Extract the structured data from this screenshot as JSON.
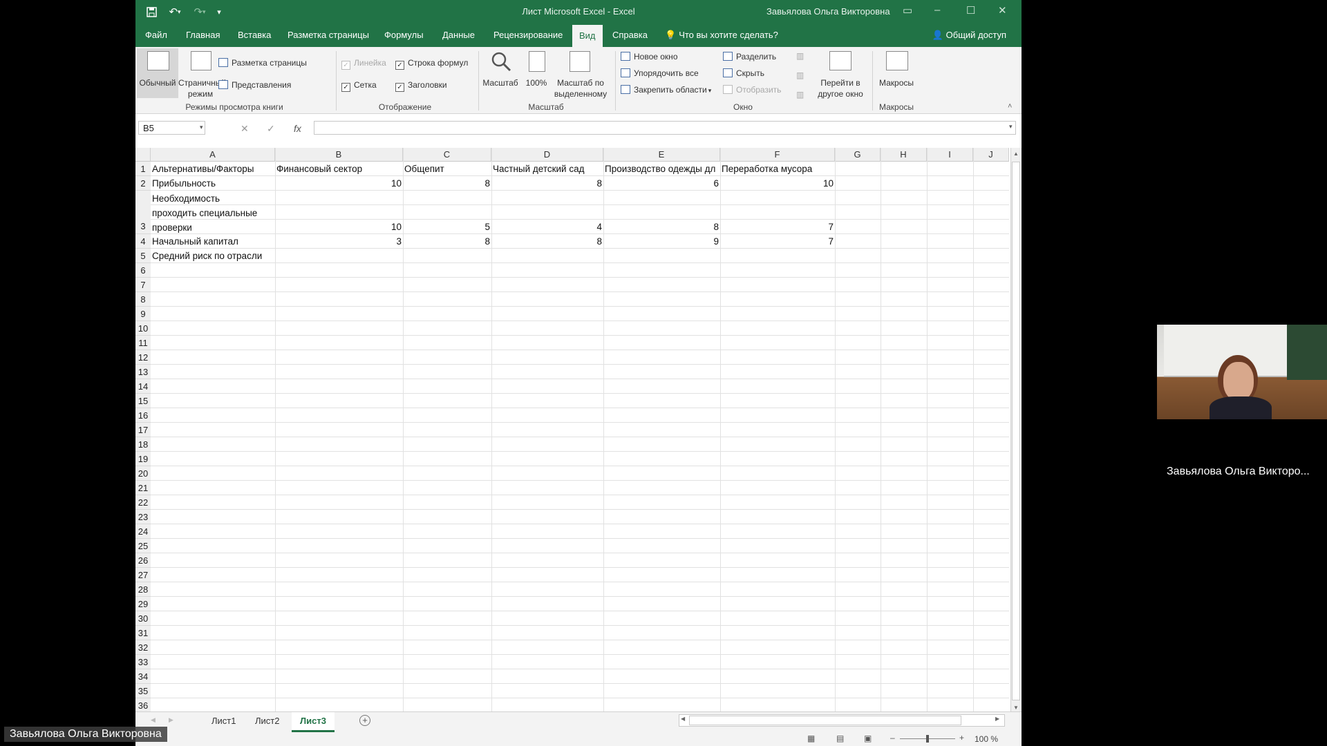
{
  "window": {
    "title": "Лист Microsoft Excel  -  Excel",
    "user": "Завьялова Ольга Викторовна"
  },
  "tabs": [
    "Файл",
    "Главная",
    "Вставка",
    "Разметка страницы",
    "Формулы",
    "Данные",
    "Рецензирование",
    "Вид",
    "Справка"
  ],
  "tell_me": "Что вы хотите сделать?",
  "share": "Общий доступ",
  "ribbon": {
    "normal": "Обычный",
    "page_break_1": "Страничный",
    "page_break_2": "режим",
    "page_layout": "Разметка страницы",
    "custom_views": "Представления",
    "group_views": "Режимы просмотра книги",
    "ruler": "Линейка",
    "formula_bar": "Строка формул",
    "gridlines": "Сетка",
    "headings": "Заголовки",
    "group_show": "Отображение",
    "zoom": "Масштаб",
    "zoom100": "100%",
    "zoom_sel_1": "Масштаб по",
    "zoom_sel_2": "выделенному",
    "group_zoom": "Масштаб",
    "new_window": "Новое окно",
    "arrange_all": "Упорядочить все",
    "freeze": "Закрепить области",
    "split": "Разделить",
    "hide": "Скрыть",
    "unhide": "Отобразить",
    "switch_1": "Перейти в",
    "switch_2": "другое окно",
    "group_window": "Окно",
    "macros": "Макросы",
    "group_macros": "Макросы"
  },
  "name_box": "B5",
  "fx": "fx",
  "columns": [
    "A",
    "B",
    "C",
    "D",
    "E",
    "F",
    "G",
    "H",
    "I",
    "J"
  ],
  "rows": [
    "1",
    "2",
    "3",
    "4",
    "5",
    "6",
    "7",
    "8",
    "9",
    "10",
    "11",
    "12",
    "13",
    "14",
    "15",
    "16",
    "17",
    "18",
    "19",
    "20",
    "21",
    "22",
    "23",
    "24",
    "25",
    "26",
    "27",
    "28",
    "29",
    "30",
    "31",
    "32",
    "33",
    "34",
    "35",
    "36"
  ],
  "cells": {
    "A1": "Альтернативы/Факторы",
    "B1": "Финансовый сектор",
    "C1": "Общепит",
    "D1": "Частный детский сад",
    "E1": "Производство одежды дл",
    "F1": "Переработка мусора",
    "A2": "Прибыльность",
    "B2": "10",
    "C2": "8",
    "D2": "8",
    "E2": "6",
    "F2": "10",
    "A3a": "Необходимость",
    "A3b": "проходить специальные",
    "A3c": "проверки",
    "B3": "10",
    "C3": "5",
    "D3": "4",
    "E3": "8",
    "F3": "7",
    "A4": "Начальный капитал",
    "B4": "3",
    "C4": "8",
    "D4": "8",
    "E4": "9",
    "F4": "7",
    "A5": "Средний риск по отрасли"
  },
  "sheets": [
    "Лист1",
    "Лист2",
    "Лист3"
  ],
  "zoom_level": "100 %",
  "video": {
    "right_name": "Завьялова Ольга Викторо...",
    "bottom_name": "Завьялова Ольга Викторовна"
  }
}
